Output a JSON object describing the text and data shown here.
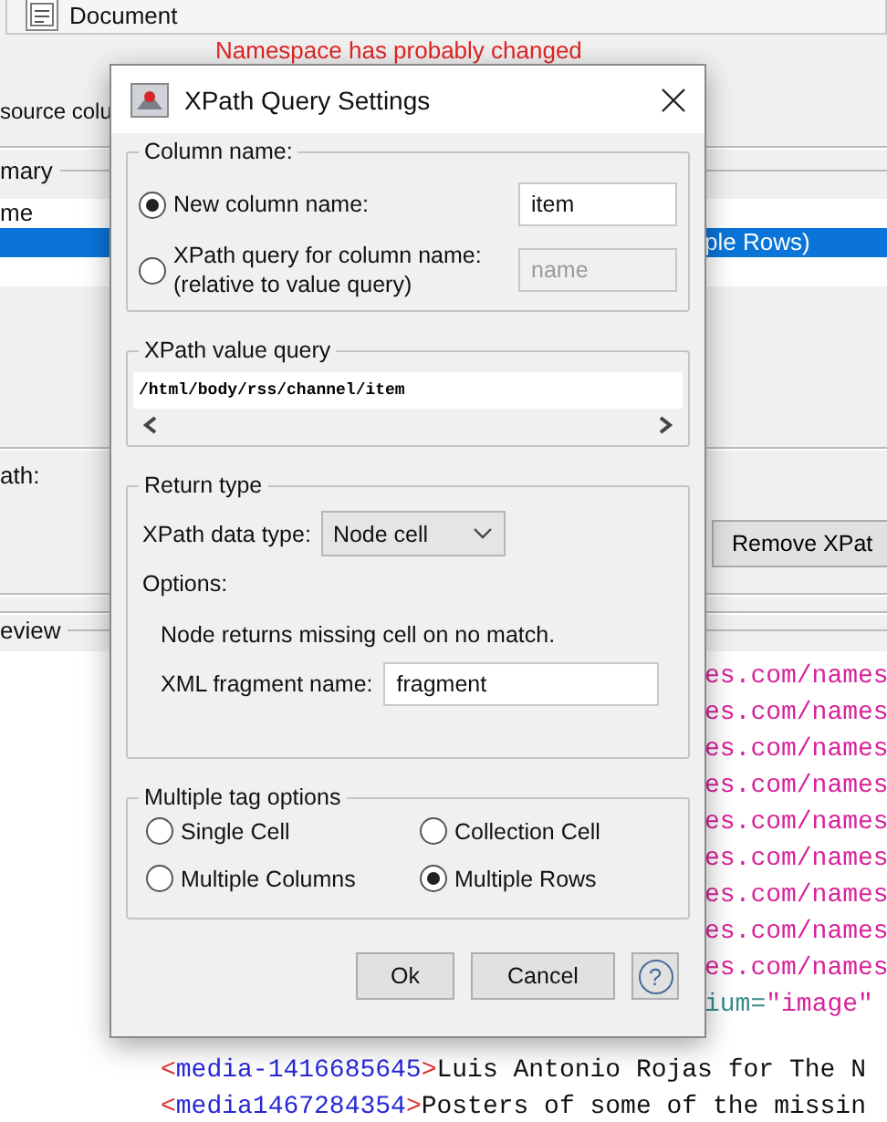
{
  "background": {
    "document_tab": "Document",
    "warning": "Namespace has probably changed",
    "source_label": "source colu",
    "summary_legend": "mary",
    "list_rows": [
      {
        "text": "me",
        "selected": false
      },
      {
        "text": "ple Rows)",
        "selected": true
      }
    ],
    "path_label": "ath:",
    "remove_button": "Remove XPat",
    "preview_legend": "eview",
    "preview_fragments": [
      [
        {
          "kind": "value",
          "text": "es.com/names"
        }
      ],
      [
        {
          "kind": "value",
          "text": "es.com/names"
        }
      ],
      [
        {
          "kind": "value",
          "text": "es.com/names"
        }
      ],
      [
        {
          "kind": "value",
          "text": "es.com/names"
        }
      ],
      [
        {
          "kind": "value",
          "text": "es.com/names"
        }
      ],
      [
        {
          "kind": "value",
          "text": "es.com/names"
        }
      ],
      [
        {
          "kind": "value",
          "text": "es.com/names"
        }
      ],
      [
        {
          "kind": "value",
          "text": "es.com/names"
        }
      ],
      [
        {
          "kind": "value",
          "text": "es.com/names"
        }
      ],
      [
        {
          "kind": "attr",
          "text": "ium="
        },
        {
          "kind": "value",
          "text": "\"image\""
        }
      ]
    ],
    "preview_lines": [
      [
        {
          "kind": "bracket",
          "text": "<"
        },
        {
          "kind": "tag",
          "text": "media-1416685645"
        },
        {
          "kind": "bracket",
          "text": ">"
        },
        {
          "kind": "text",
          "text": "Luis Antonio Rojas for The N"
        }
      ],
      [
        {
          "kind": "bracket",
          "text": "<"
        },
        {
          "kind": "tag",
          "text": "media1467284354"
        },
        {
          "kind": "bracket",
          "text": ">"
        },
        {
          "kind": "text",
          "text": "Posters of some of the missin"
        }
      ]
    ]
  },
  "dialog": {
    "title": "XPath Query Settings",
    "column_name": {
      "legend": "Column name:",
      "options": [
        {
          "label": "New column name:",
          "selected": true,
          "field": {
            "value": "item",
            "disabled": false
          }
        },
        {
          "label": "XPath query for column name:",
          "sublabel": "(relative to value query)",
          "selected": false,
          "field": {
            "value": "name",
            "disabled": true
          }
        }
      ]
    },
    "value_query": {
      "legend": "XPath value query",
      "value": "/html/body/rss/channel/item"
    },
    "return_type": {
      "legend": "Return type",
      "data_type_label": "XPath data type:",
      "data_type": "Node cell",
      "options_label": "Options:",
      "note": "Node returns missing cell on no match.",
      "fragment_label": "XML fragment name:",
      "fragment_value": "fragment"
    },
    "multiple_tag": {
      "legend": "Multiple tag options",
      "options": [
        {
          "label": "Single Cell",
          "selected": false
        },
        {
          "label": "Collection Cell",
          "selected": false
        },
        {
          "label": "Multiple Columns",
          "selected": false
        },
        {
          "label": "Multiple Rows",
          "selected": true
        }
      ]
    },
    "buttons": [
      {
        "kind": "text",
        "label": "Ok"
      },
      {
        "kind": "text",
        "label": "Cancel"
      },
      {
        "kind": "help",
        "label": "?"
      }
    ]
  }
}
